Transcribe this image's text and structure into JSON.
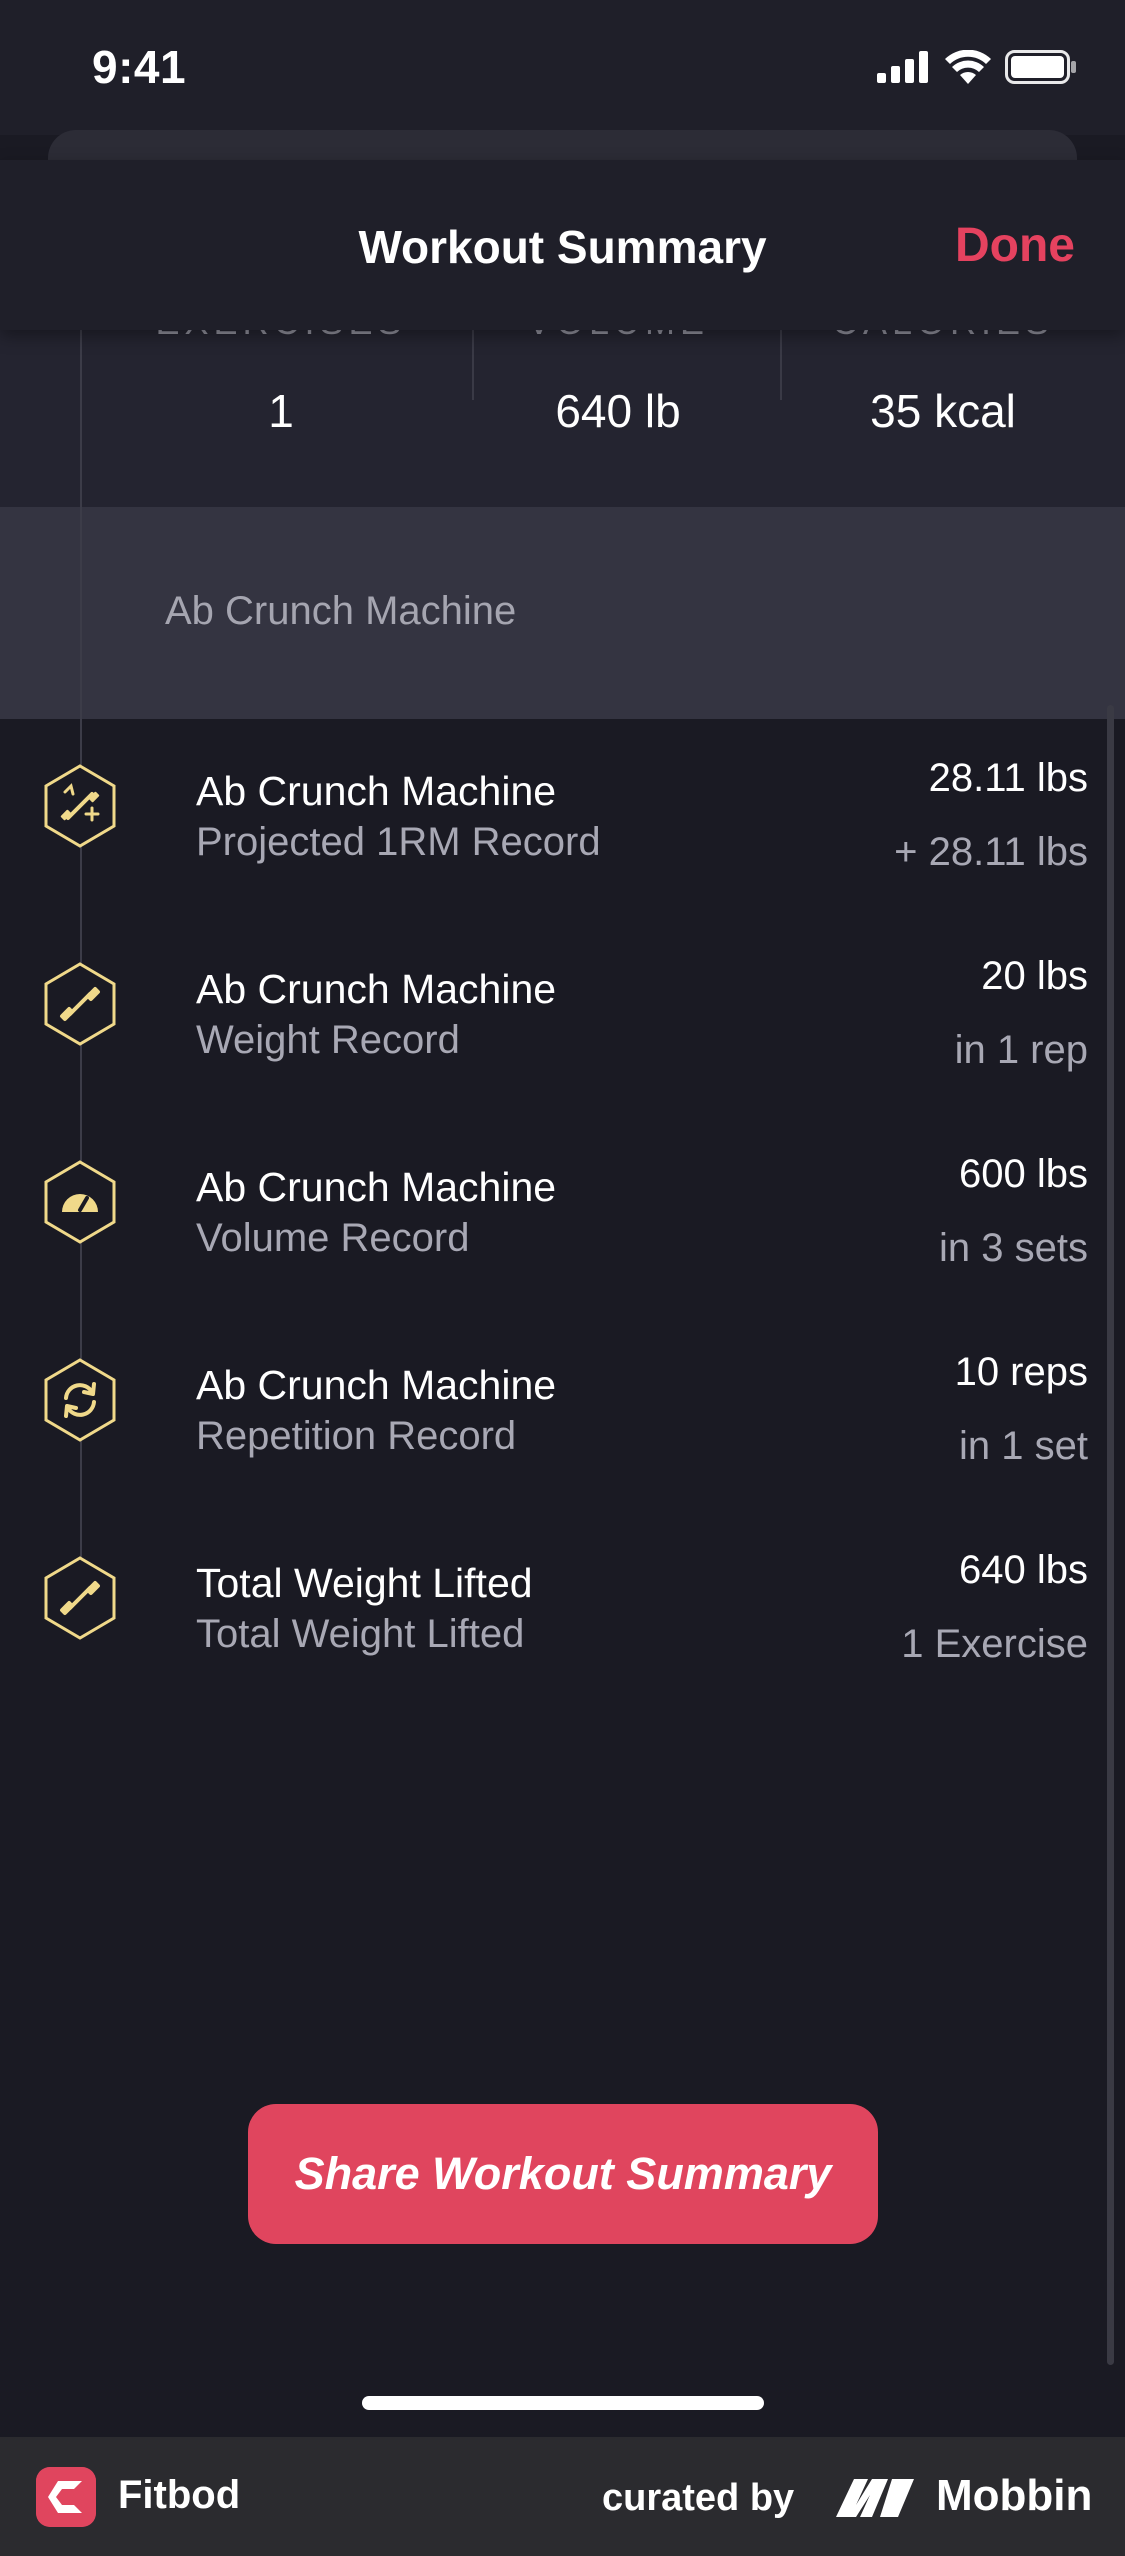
{
  "status_bar": {
    "time": "9:41"
  },
  "nav": {
    "title": "Workout Summary",
    "done_label": "Done"
  },
  "stats": [
    {
      "label": "EXERCISES",
      "value": "1"
    },
    {
      "label": "VOLUME",
      "value": "640 lb"
    },
    {
      "label": "CALORIES",
      "value": "35 kcal"
    }
  ],
  "section": {
    "title": "Ab Crunch Machine"
  },
  "records": [
    {
      "icon": "projected-1rm-icon",
      "name": "Ab Crunch Machine",
      "type": "Projected 1RM Record",
      "value": "28.11 lbs",
      "detail": "+ 28.11 lbs"
    },
    {
      "icon": "dumbbell-icon",
      "name": "Ab Crunch Machine",
      "type": "Weight Record",
      "value": "20 lbs",
      "detail": "in 1 rep"
    },
    {
      "icon": "gauge-icon",
      "name": "Ab Crunch Machine",
      "type": "Volume Record",
      "value": "600 lbs",
      "detail": "in 3 sets"
    },
    {
      "icon": "repeat-icon",
      "name": "Ab Crunch Machine",
      "type": "Repetition Record",
      "value": "10 reps",
      "detail": "in 1 set"
    },
    {
      "icon": "dumbbell-icon",
      "name": "Total Weight Lifted",
      "type": "Total Weight Lifted",
      "value": "640 lbs",
      "detail": "1 Exercise"
    }
  ],
  "share_button": {
    "label": "Share Workout Summary"
  },
  "footer": {
    "app_name": "Fitbod",
    "curated_by": "curated by",
    "brand": "Mobbin"
  },
  "colors": {
    "accent": "#e0455e",
    "background": "#1a1a23",
    "icon_gold": "#f0d98a"
  }
}
